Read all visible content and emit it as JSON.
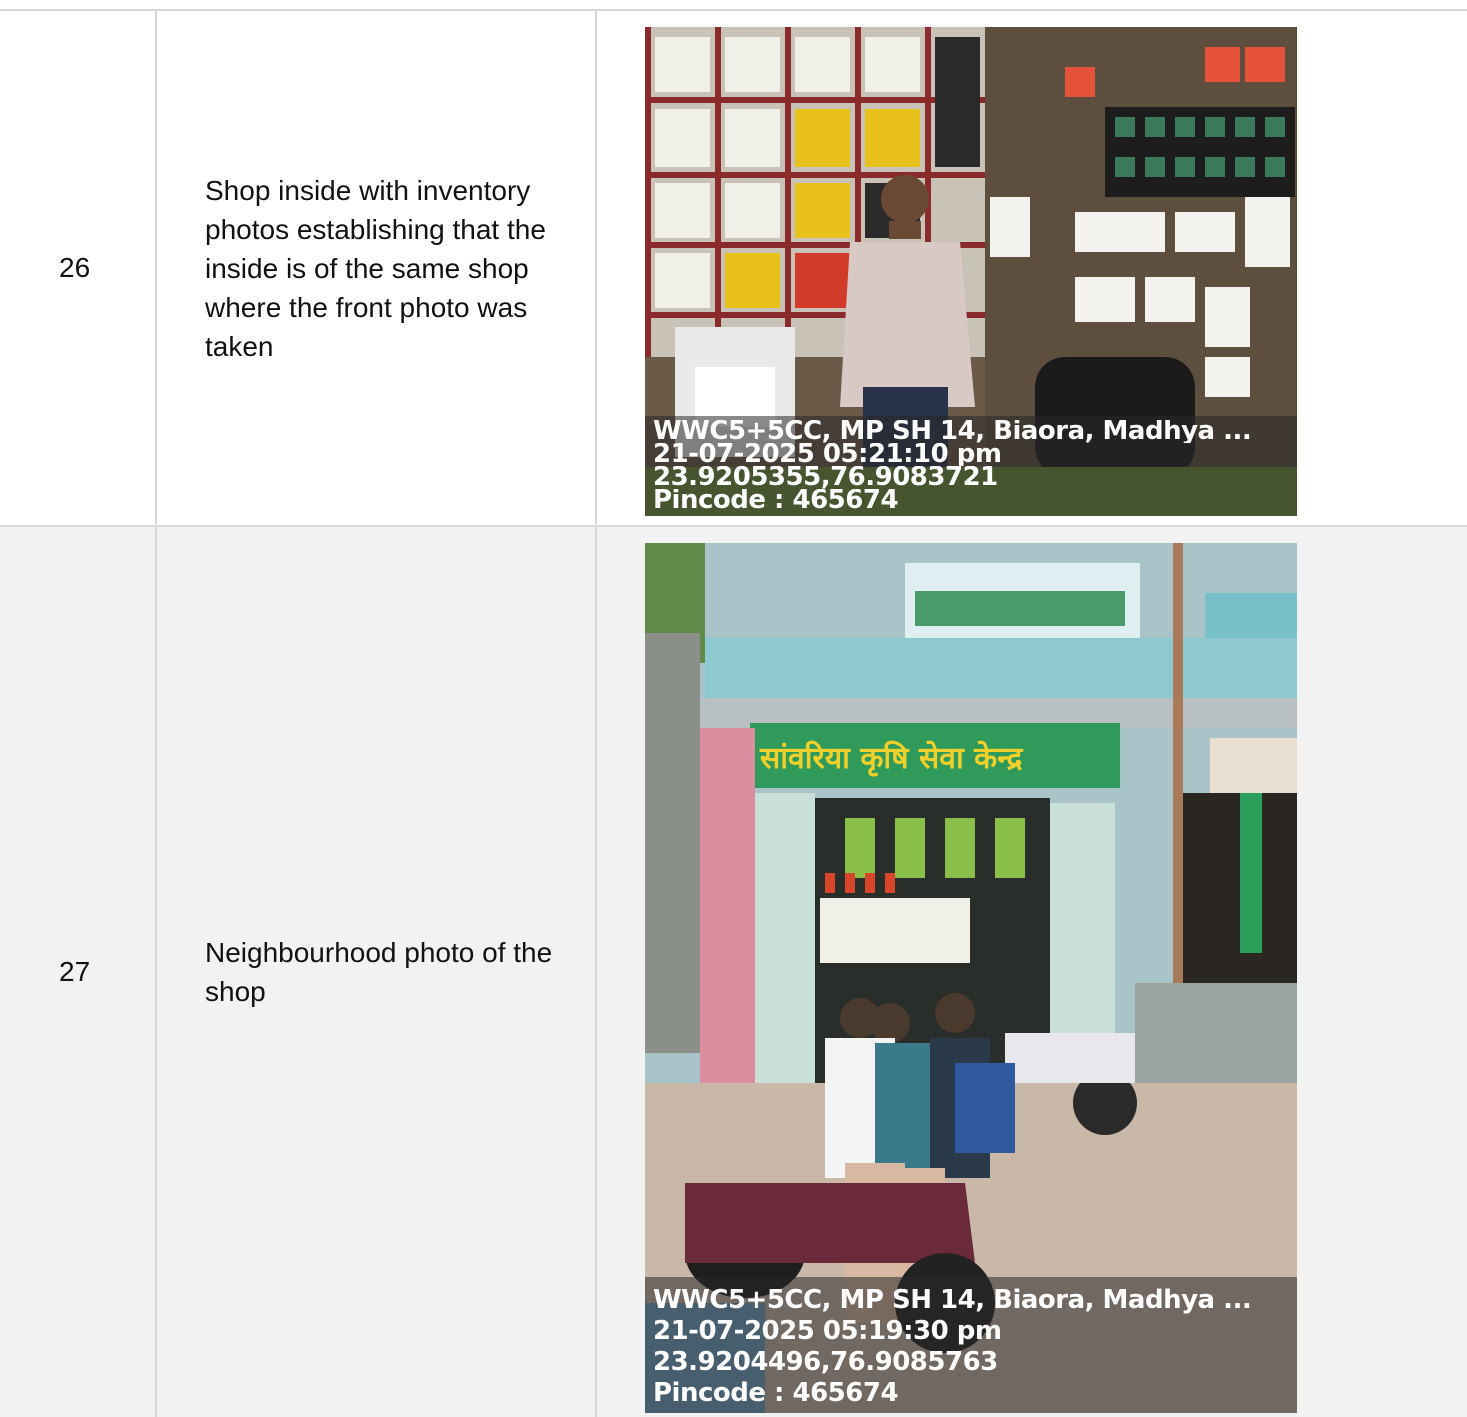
{
  "rows": [
    {
      "number": "26",
      "description": "Shop inside with inventory photos establishing that the inside is of the same shop where the front photo was taken",
      "photo": {
        "subject": "shop interior with shelves of electrical inventory and shopkeeper",
        "stamp_lines": [
          "WWC5+5CC, MP SH 14, Biaora, Madhya ...",
          "21-07-2025 05:21:10 pm",
          "23.9205355,76.9083721",
          "Pincode : 465674"
        ]
      }
    },
    {
      "number": "27",
      "description": "Neighbourhood photo of the shop",
      "photo": {
        "subject": "street view of shop front with motorcyclists",
        "signboard": "सांवरिया कृषि सेवा केन्द्र",
        "stamp_lines": [
          "WWC5+5CC, MP SH 14, Biaora, Madhya ...",
          "21-07-2025 05:19:30 pm",
          "23.9204496,76.9085763",
          "Pincode : 465674"
        ]
      }
    }
  ]
}
